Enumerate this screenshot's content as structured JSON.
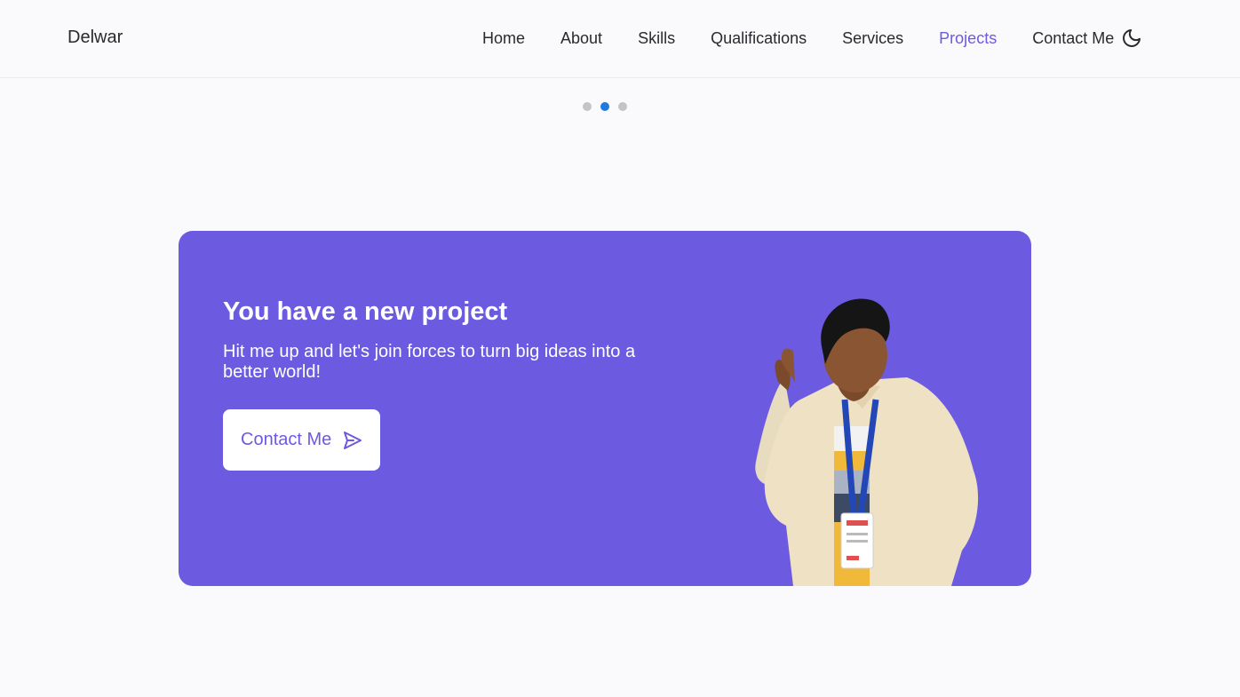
{
  "header": {
    "logo": "Delwar",
    "nav": [
      {
        "label": "Home",
        "active": false
      },
      {
        "label": "About",
        "active": false
      },
      {
        "label": "Skills",
        "active": false
      },
      {
        "label": "Qualifications",
        "active": false
      },
      {
        "label": "Services",
        "active": false
      },
      {
        "label": "Projects",
        "active": true
      },
      {
        "label": "Contact Me",
        "active": false
      }
    ],
    "theme_icon": "moon-icon"
  },
  "carousel": {
    "slide_count": 3,
    "active_index": 1
  },
  "cta": {
    "title": "You have a new project",
    "subtitle": "Hit me up and let's join forces to turn big ideas into a better world!",
    "button_label": "Contact Me",
    "button_icon": "send-icon",
    "image": "person-photo"
  },
  "colors": {
    "accent": "#6c5ae0",
    "carousel_active": "#1f7ae0",
    "carousel_inactive": "#c4c4c8",
    "background": "#fafafc"
  }
}
